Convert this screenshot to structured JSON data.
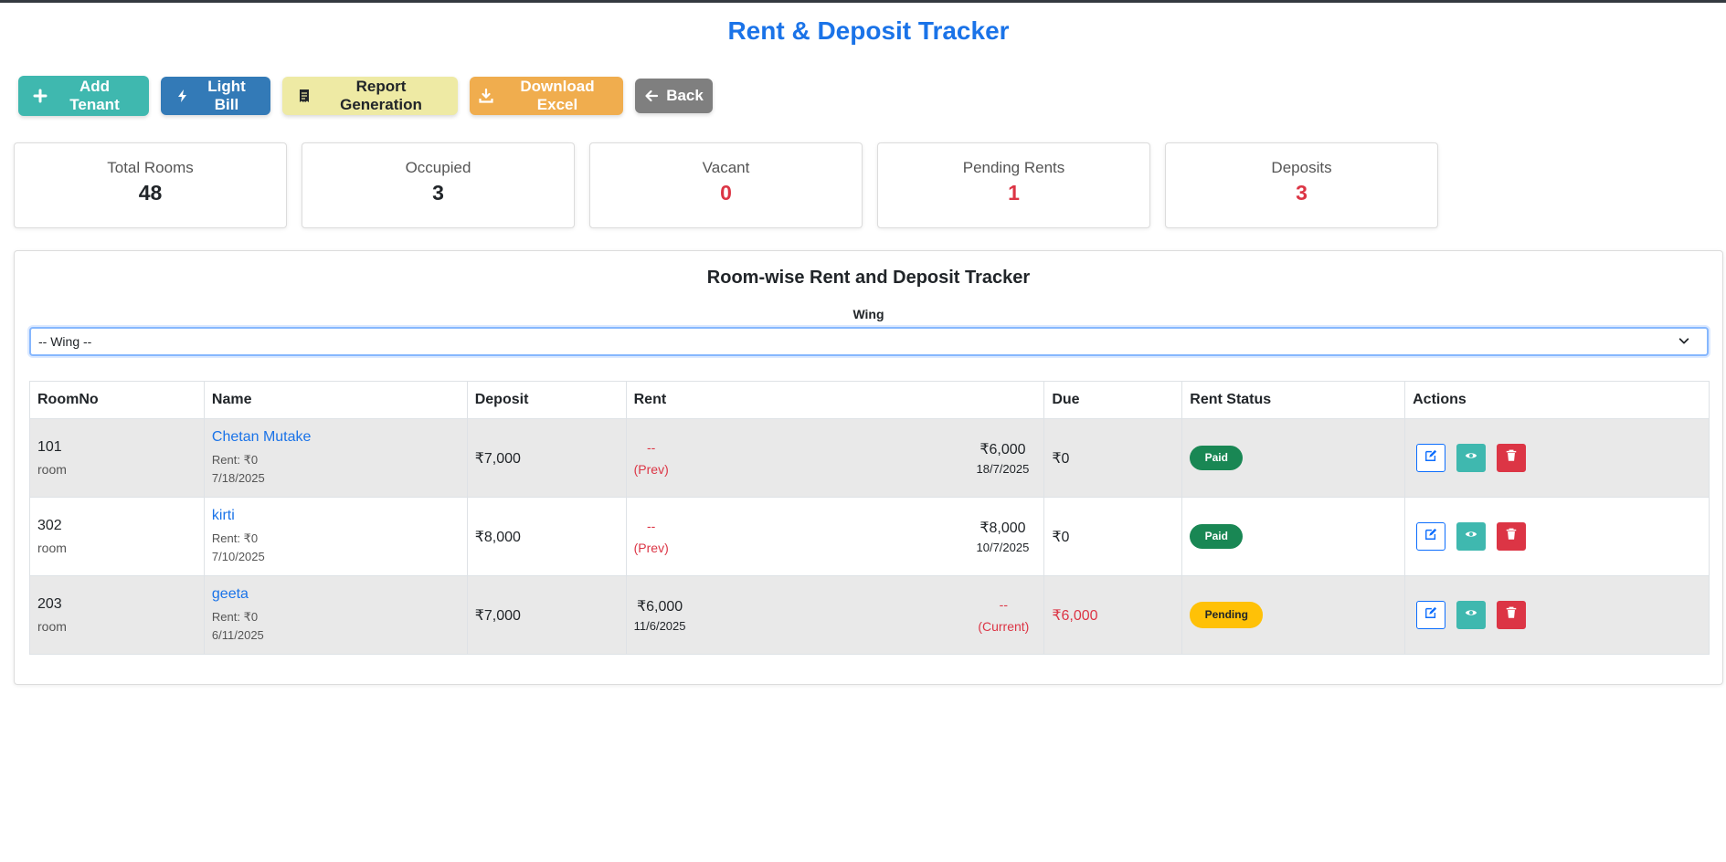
{
  "title": "Rent & Deposit Tracker",
  "toolbar": {
    "add_tenant": "Add Tenant",
    "light_bill": "Light Bill",
    "report": "Report Generation",
    "download": "Download Excel",
    "back": "Back"
  },
  "stats": [
    {
      "label": "Total Rooms",
      "value": "48",
      "color": "#212529"
    },
    {
      "label": "Occupied",
      "value": "3",
      "color": "#212529"
    },
    {
      "label": "Vacant",
      "value": "0",
      "color": "#dc3545"
    },
    {
      "label": "Pending Rents",
      "value": "1",
      "color": "#dc3545"
    },
    {
      "label": "Deposits",
      "value": "3",
      "color": "#dc3545"
    }
  ],
  "panel": {
    "title": "Room-wise Rent and Deposit Tracker",
    "wing_label": "Wing",
    "wing_selected": "-- Wing --"
  },
  "table": {
    "headers": [
      "RoomNo",
      "Name",
      "Deposit",
      "Rent",
      "Due",
      "Rent Status",
      "Actions"
    ],
    "rows": [
      {
        "room": "101",
        "room_type": "room",
        "name": "Chetan Mutake",
        "rent_line": "Rent: ₹0",
        "date": "7/18/2025",
        "deposit": "₹7,000",
        "prev_dash": "--",
        "prev_label": "(Prev)",
        "current_amount": "₹6,000",
        "current_date": "18/7/2025",
        "due": "₹0",
        "status": "Paid"
      },
      {
        "room": "302",
        "room_type": "room",
        "name": "kirti",
        "rent_line": "Rent: ₹0",
        "date": "7/10/2025",
        "deposit": "₹8,000",
        "prev_dash": "--",
        "prev_label": "(Prev)",
        "current_amount": "₹8,000",
        "current_date": "10/7/2025",
        "due": "₹0",
        "status": "Paid"
      },
      {
        "room": "203",
        "room_type": "room",
        "name": "geeta",
        "rent_line": "Rent: ₹0",
        "date": "6/11/2025",
        "deposit": "₹7,000",
        "prev_amount": "₹6,000",
        "prev_date": "11/6/2025",
        "current_dash": "--",
        "current_label": "(Current)",
        "due": "₹6,000",
        "status": "Pending"
      }
    ]
  },
  "colors": {
    "title_blue": "#1a73e8",
    "teal": "#3fb8af",
    "blue": "#337ab7",
    "yellow": "#eeeaa4",
    "orange": "#f0ad4e",
    "gray": "#7f7f7f",
    "paid": "#198754",
    "pending": "#ffc107",
    "danger": "#dc3545"
  },
  "icons": {
    "add_tenant": "plus-icon",
    "light_bill": "bolt-icon",
    "report": "receipt-icon",
    "download": "download-icon",
    "back": "arrow-left-icon",
    "edit": "edit-icon",
    "view": "eye-icon",
    "delete": "trash-icon",
    "select": "chevron-down-icon"
  }
}
